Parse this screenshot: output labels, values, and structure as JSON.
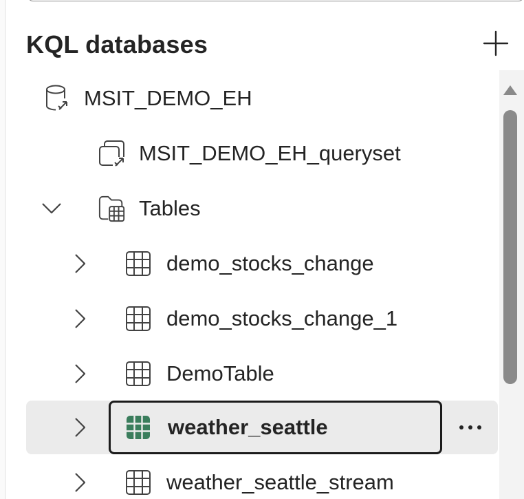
{
  "panel": {
    "title": "KQL databases",
    "add_icon": "plus-icon"
  },
  "tree": {
    "database": {
      "label": "MSIT_DEMO_EH",
      "icon": "kql-database-icon"
    },
    "queryset": {
      "label": "MSIT_DEMO_EH_queryset",
      "icon": "queryset-icon"
    },
    "tables_folder": {
      "label": "Tables",
      "icon": "tables-folder-icon",
      "expanded": true
    },
    "tables": [
      {
        "label": "demo_stocks_change",
        "icon": "table-icon",
        "selected": false
      },
      {
        "label": "demo_stocks_change_1",
        "icon": "table-icon",
        "selected": false
      },
      {
        "label": "DemoTable",
        "icon": "table-icon",
        "selected": false
      },
      {
        "label": "weather_seattle",
        "icon": "table-icon",
        "selected": true
      },
      {
        "label": "weather_seattle_stream",
        "icon": "table-icon",
        "selected": false
      }
    ]
  },
  "colors": {
    "selected_row_bg": "#ebebeb",
    "selected_icon": "#3a7d5c",
    "text": "#242424"
  }
}
